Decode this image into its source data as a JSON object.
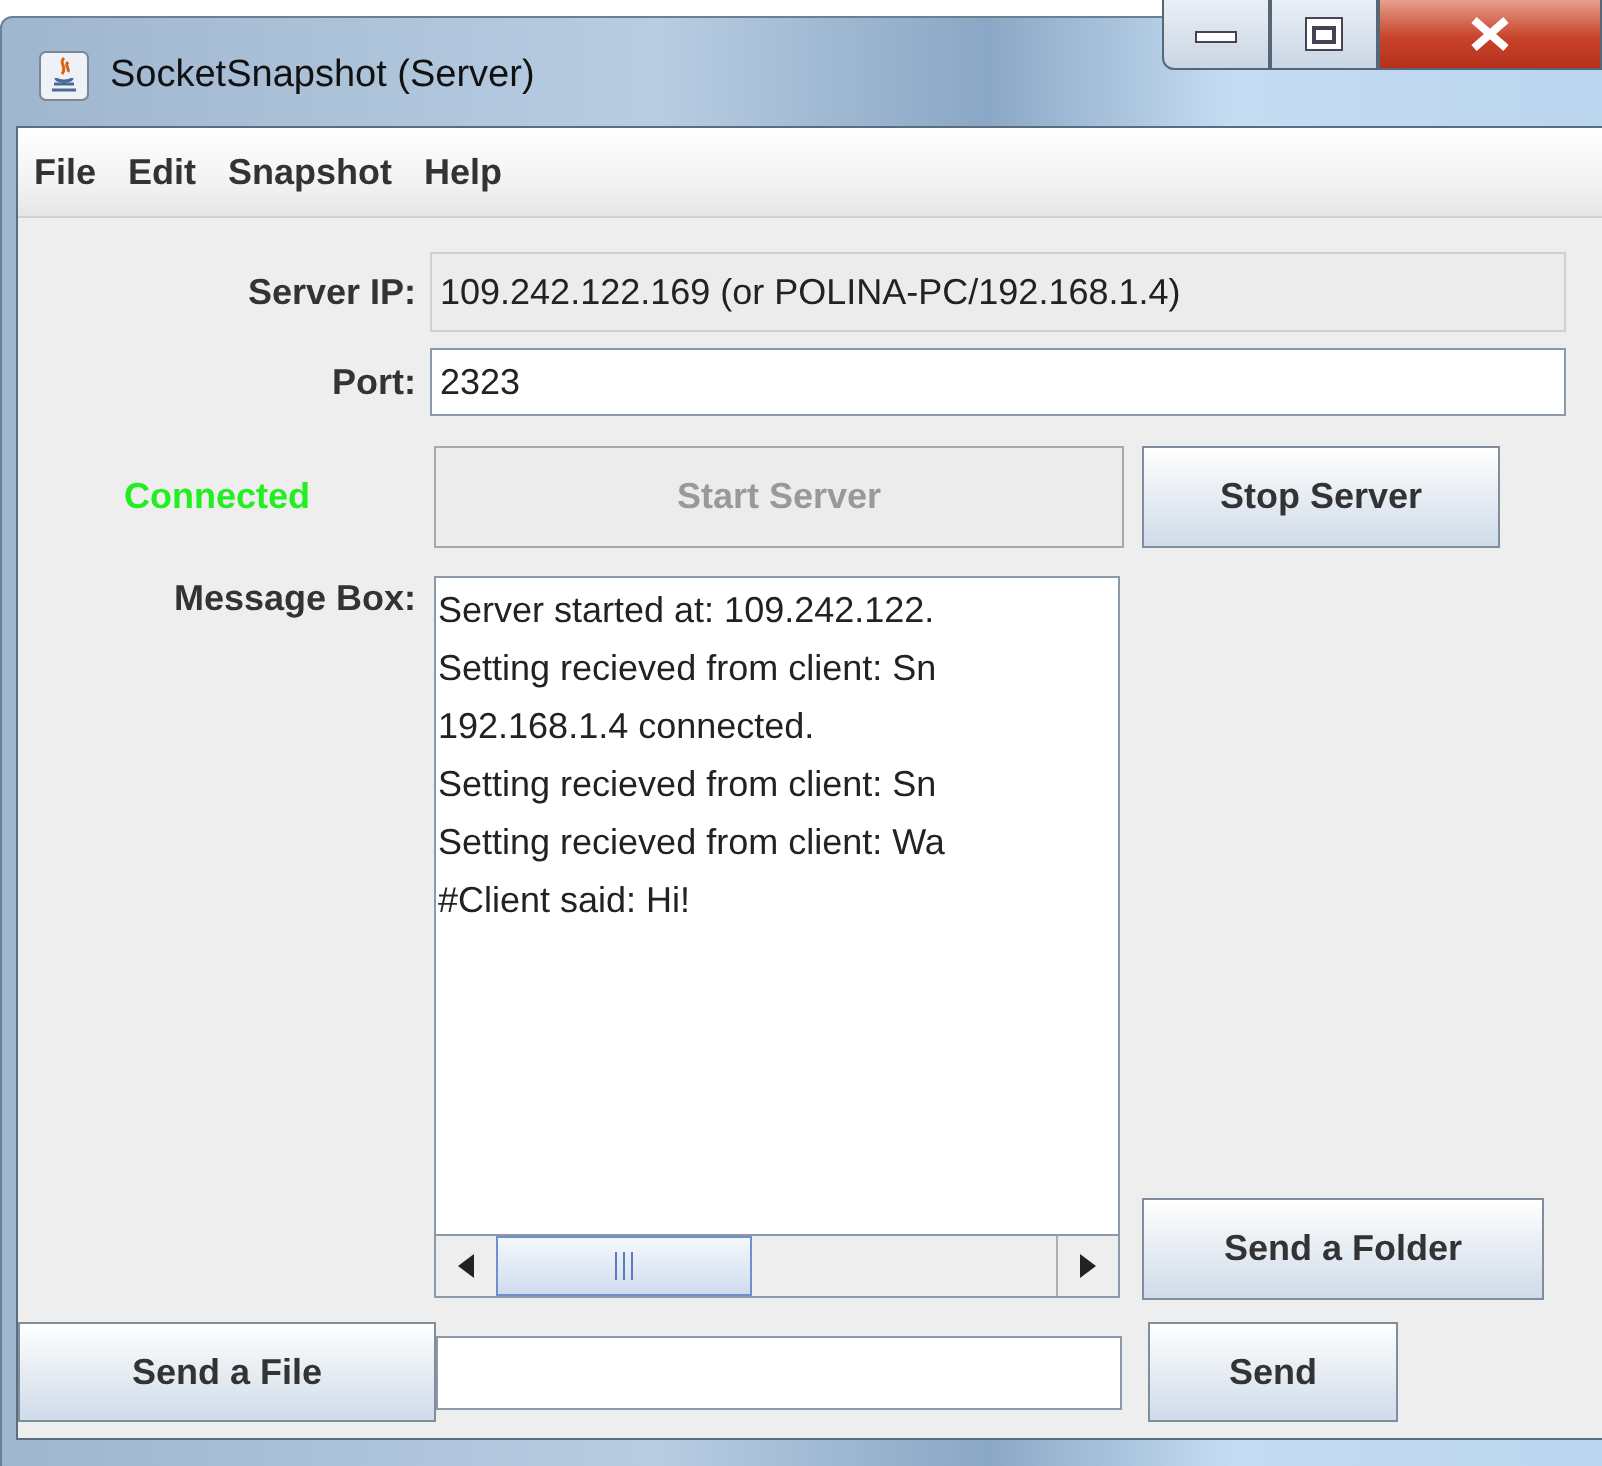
{
  "window": {
    "title": "SocketSnapshot (Server)"
  },
  "menu": [
    "File",
    "Edit",
    "Snapshot",
    "Help"
  ],
  "server_ip": {
    "label": "Server IP:",
    "value": "109.242.122.169 (or POLINA-PC/192.168.1.4)",
    "editable": false
  },
  "port": {
    "label": "Port:",
    "value": "2323",
    "editable": true
  },
  "status": {
    "text": "Connected",
    "connected": true
  },
  "start_button": {
    "label": "Start Server",
    "disabled": true
  },
  "stop_button": {
    "label": "Stop Server",
    "disabled": false
  },
  "message_box": {
    "label": "Message Box:",
    "lines": [
      "Server started at: 109.242.122.",
      "Setting recieved from client: Sn",
      "192.168.1.4 connected.",
      "Setting recieved from client: Sn",
      "Setting recieved from client: Wa",
      "#Client said: Hi!"
    ]
  },
  "send_folder_button": {
    "label": "Send a Folder",
    "disabled": false
  },
  "send_file_button": {
    "label": "Send a File",
    "disabled": false
  },
  "send_button": {
    "label": "Send",
    "disabled": false
  }
}
